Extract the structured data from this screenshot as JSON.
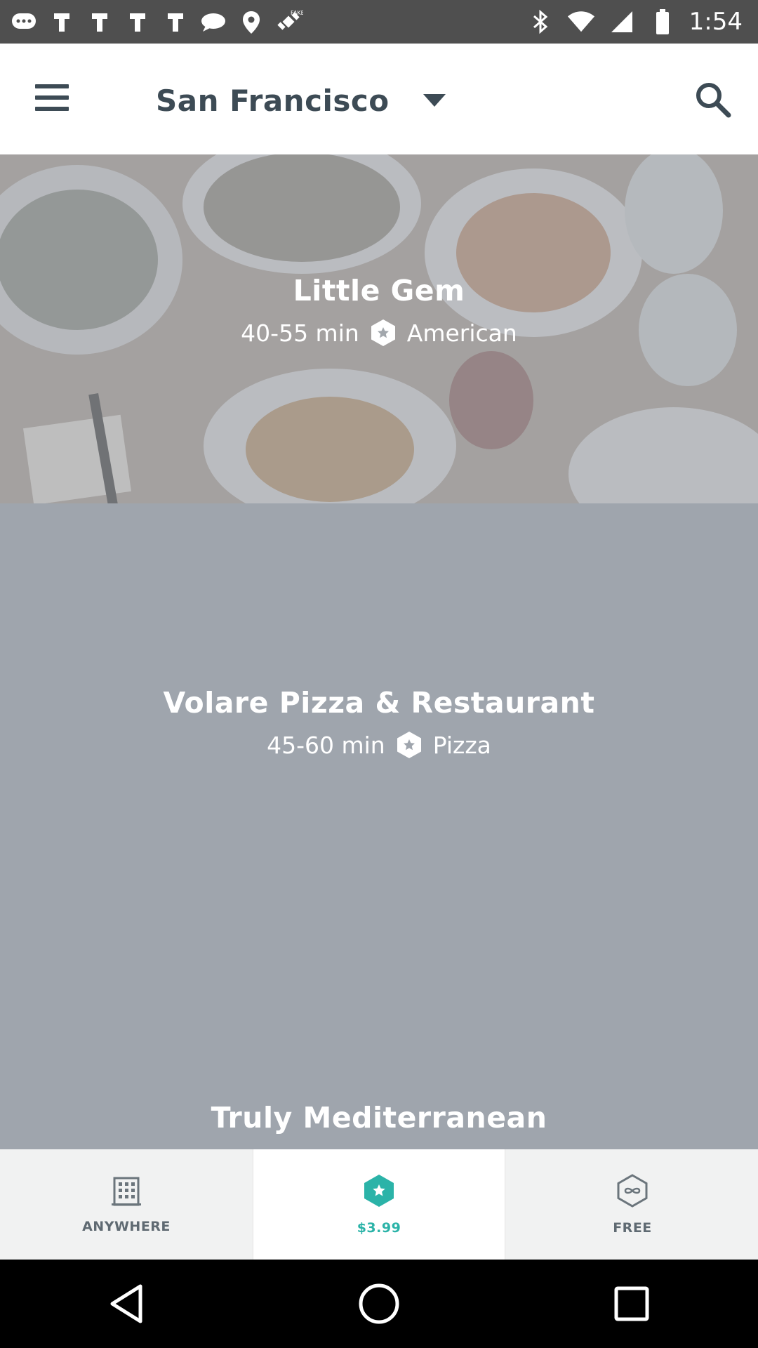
{
  "status_bar": {
    "time": "1:54",
    "icons": [
      "message-icon",
      "app-icon",
      "app-icon",
      "app-icon",
      "app-icon",
      "chat-icon",
      "location-icon",
      "fake-gps-icon",
      "bluetooth-icon",
      "wifi-icon",
      "signal-icon",
      "battery-icon"
    ]
  },
  "header": {
    "city": "San Francisco",
    "menu_icon": "hamburger-menu-icon",
    "dropdown_icon": "caret-down-icon",
    "search_icon": "search-icon"
  },
  "restaurants": [
    {
      "name": "Little Gem",
      "time": "40-55 min",
      "cuisine": "American"
    },
    {
      "name": "Volare Pizza & Restaurant",
      "time": "45-60 min",
      "cuisine": "Pizza"
    },
    {
      "name": "Truly Mediterranean"
    }
  ],
  "filters": [
    {
      "label": "ANYWHERE",
      "icon": "building-icon",
      "active": false
    },
    {
      "label": "$3.99",
      "icon": "star-hexagon-icon",
      "active": true,
      "color": "#2bb3a8"
    },
    {
      "label": "FREE",
      "icon": "infinity-hexagon-icon",
      "active": false
    }
  ],
  "nav": {
    "back": "back-icon",
    "home": "home-icon",
    "recents": "recents-icon"
  }
}
